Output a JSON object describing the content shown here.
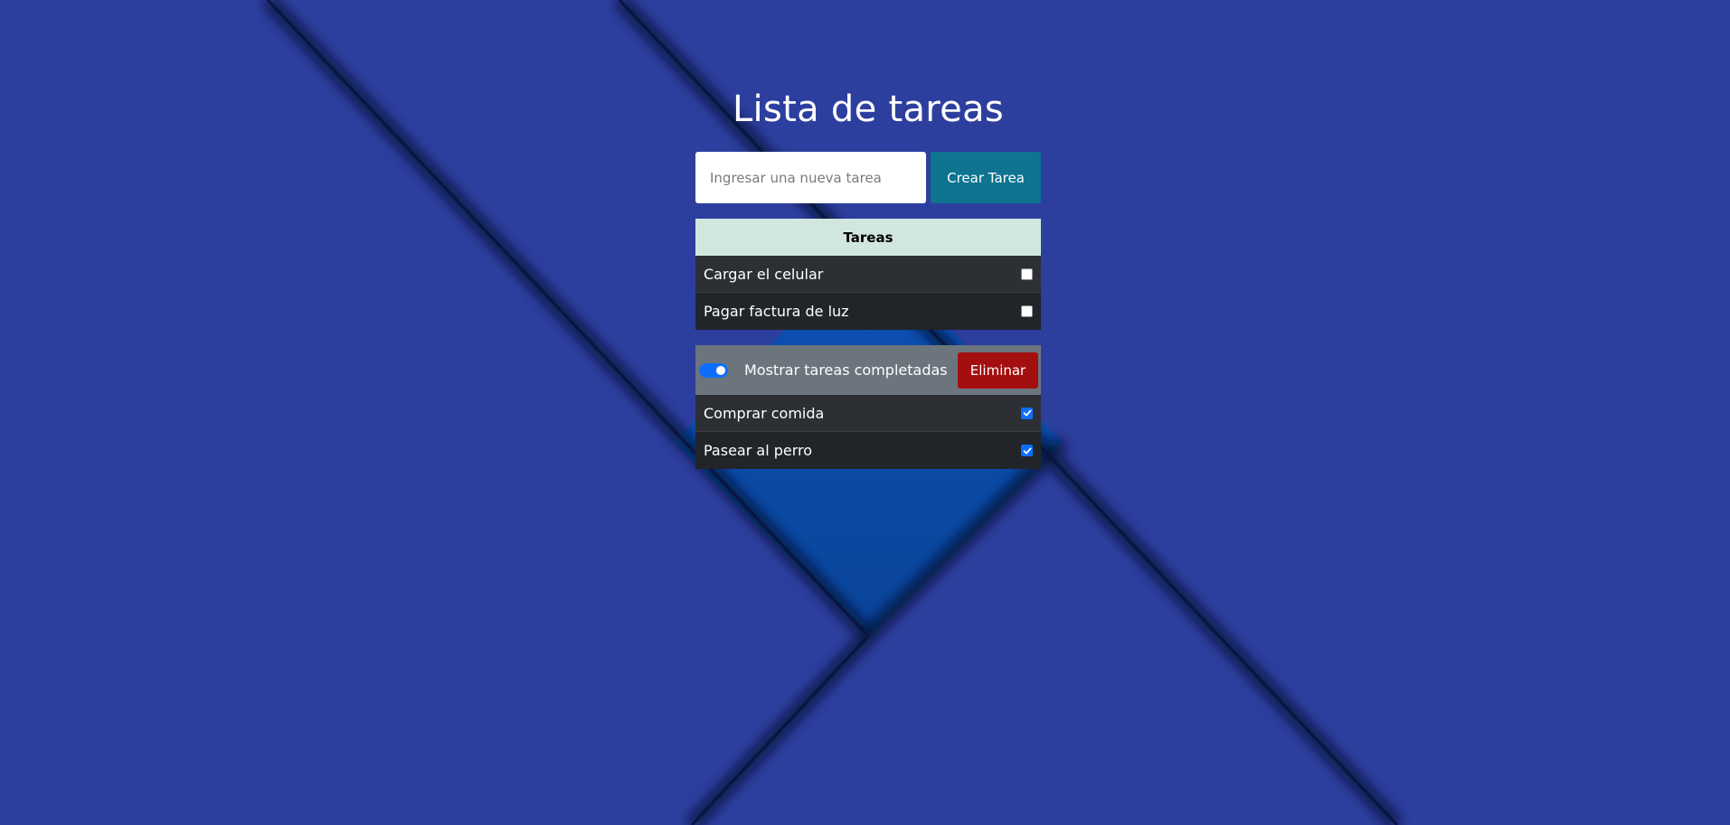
{
  "app": {
    "title": "Lista de tareas"
  },
  "new_task": {
    "placeholder": "Ingresar una nueva tarea",
    "value": "",
    "create_label": "Crear Tarea"
  },
  "pending": {
    "header": "Tareas",
    "items": [
      {
        "label": "Cargar el celular",
        "done": false
      },
      {
        "label": "Pagar factura de luz",
        "done": false
      }
    ]
  },
  "completed": {
    "toggle_label": "Mostrar tareas completadas",
    "toggle_on": true,
    "delete_label": "Eliminar",
    "items": [
      {
        "label": "Comprar comida",
        "done": true
      },
      {
        "label": "Pasear al perro",
        "done": true
      }
    ]
  },
  "colors": {
    "background": "#2d3f9e",
    "accent_blue": "#0d6efd",
    "create_button": "#0e7490",
    "delete_button": "#a30f0f",
    "header_green": "#d1e7dd"
  }
}
